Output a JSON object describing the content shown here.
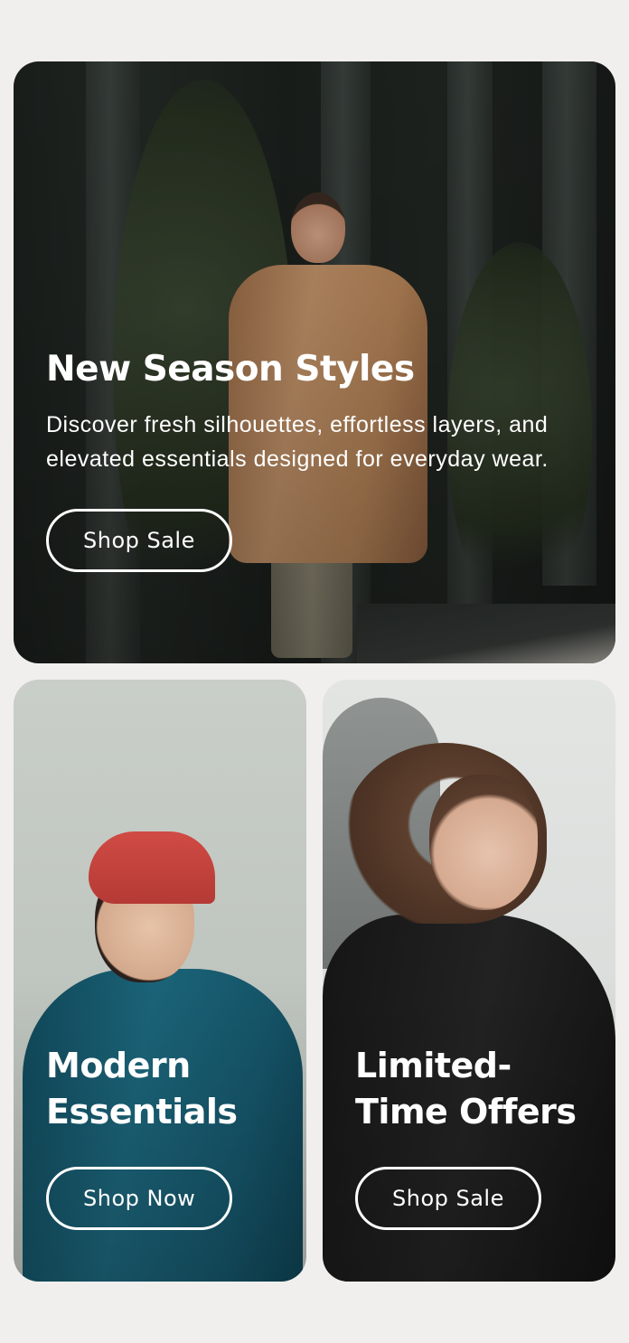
{
  "hero": {
    "title": "New Season Styles",
    "description": "Discover fresh silhouettes, effortless layers, and elevated essentials designed for everyday wear.",
    "button_label": "Shop Sale"
  },
  "cards": [
    {
      "title": "Modern Essentials",
      "button_label": "Shop Now"
    },
    {
      "title": "Limited-Time Offers",
      "button_label": "Shop Sale"
    }
  ],
  "colors": {
    "page_background": "#f0efed",
    "text": "#ffffff",
    "button_border": "#ffffff"
  }
}
